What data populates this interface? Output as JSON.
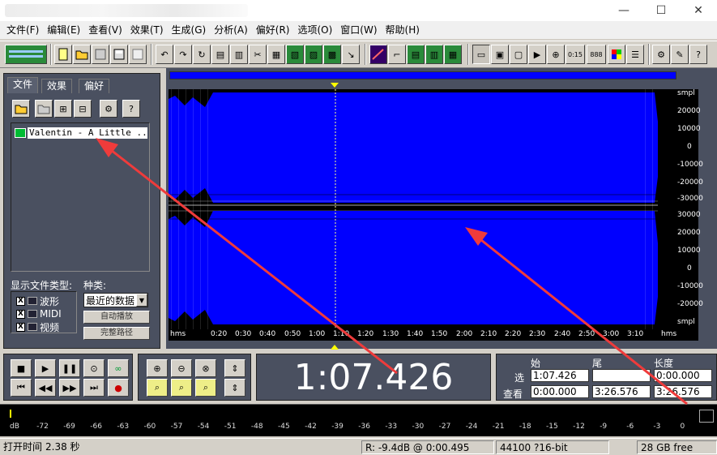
{
  "window": {
    "controls": {
      "minimize": "—",
      "maximize": "☐",
      "close": "✕"
    }
  },
  "menu": [
    "文件(F)",
    "编辑(E)",
    "查看(V)",
    "效果(T)",
    "生成(G)",
    "分析(A)",
    "偏好(R)",
    "选项(O)",
    "窗口(W)",
    "帮助(H)"
  ],
  "left_panel": {
    "tabs": [
      "文件",
      "效果",
      "偏好"
    ],
    "file_entry": "Valentin - A Little ...",
    "filetype_label": "显示文件类型:",
    "kind_label": "种类:",
    "filetypes": [
      {
        "label": "波形",
        "checked": "X"
      },
      {
        "label": "MIDI",
        "checked": "X"
      },
      {
        "label": "视频",
        "checked": "X"
      }
    ],
    "kind_value": "最近的数据",
    "autoplay_label": "自动播放",
    "fullpath_label": "完整路径"
  },
  "waveform": {
    "y_unit": "smpl",
    "y_labels_ch1": [
      "smpl",
      "20000",
      "10000",
      "0",
      "-10000",
      "-20000",
      "-30000"
    ],
    "y_labels_ch2": [
      "30000",
      "20000",
      "10000",
      "0",
      "-10000",
      "-20000",
      "smpl"
    ],
    "x_labels": [
      "hms",
      "0:20",
      "0:30",
      "0:40",
      "0:50",
      "1:00",
      "1:10",
      "1:20",
      "1:30",
      "1:40",
      "1:50",
      "2:00",
      "2:10",
      "2:20",
      "2:30",
      "2:40",
      "2:50",
      "3:00",
      "3:10",
      "hms"
    ]
  },
  "time_display": "1:07.426",
  "selection": {
    "headers": {
      "begin": "始",
      "end": "尾",
      "length": "长度"
    },
    "rows": [
      {
        "label": "选",
        "begin": "1:07.426",
        "end": "",
        "length": "0:00.000"
      },
      {
        "label": "查看",
        "begin": "0:00.000",
        "end": "3:26.576",
        "length": "3:26.576"
      }
    ]
  },
  "level_meter": {
    "db_labels": [
      "dB",
      "-72",
      "-69",
      "-66",
      "-63",
      "-60",
      "-57",
      "-54",
      "-51",
      "-48",
      "-45",
      "-42",
      "-39",
      "-36",
      "-33",
      "-30",
      "-27",
      "-24",
      "-21",
      "-18",
      "-15",
      "-12",
      "-9",
      "-6",
      "-3",
      "0"
    ]
  },
  "status": {
    "open_time_label": "打开时间",
    "open_time_value": "2.38 秒",
    "cursor": "R: -9.4dB @  0:00.495",
    "format": "44100 ?16-bit",
    "free": "28 GB free"
  },
  "colors": {
    "wave": "#0000ff",
    "panel": "#4a5060",
    "marker": "#ffff00",
    "annotation_arrow": "#ef3b3b"
  }
}
